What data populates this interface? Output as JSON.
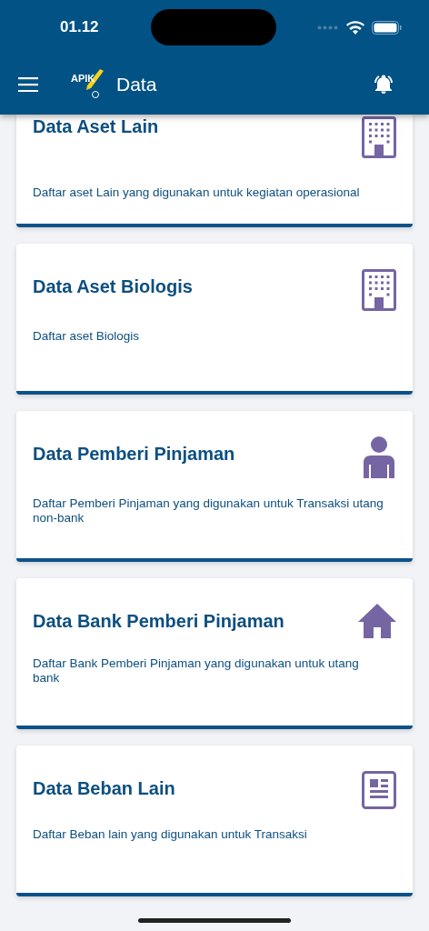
{
  "status_bar": {
    "time": "01.12"
  },
  "app_bar": {
    "logo_text": "APIK",
    "title": "Data"
  },
  "cards": [
    {
      "title": "Data Aset Lain",
      "description": "Daftar aset Lain yang digunakan untuk kegiatan operasional",
      "kind": "building"
    },
    {
      "title": "Data Aset Biologis",
      "description": "Daftar aset Biologis",
      "kind": "building"
    },
    {
      "title": "Data Pemberi Pinjaman",
      "description": "Daftar Pemberi Pinjaman yang digunakan untuk Transaksi utang non-bank",
      "kind": "person"
    },
    {
      "title": "Data Bank Pemberi Pinjaman",
      "description": "Daftar Bank Pemberi Pinjaman yang digunakan untuk utang bank",
      "kind": "house"
    },
    {
      "title": "Data Beban Lain",
      "description": "Daftar Beban lain yang digunakan untuk Transaksi",
      "kind": "article"
    }
  ]
}
